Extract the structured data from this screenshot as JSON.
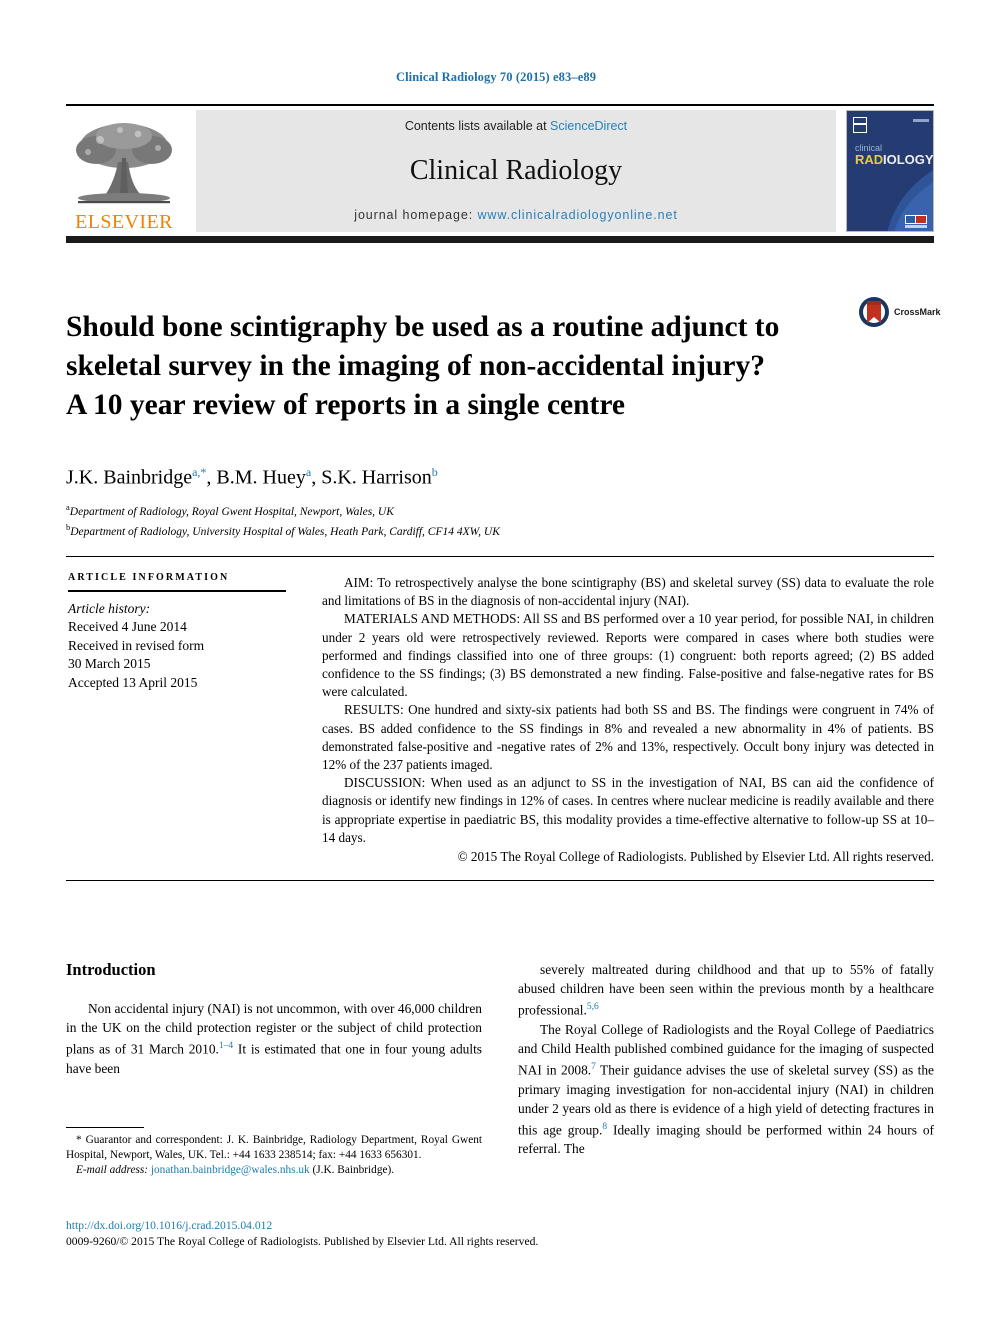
{
  "running_head": "Clinical Radiology 70 (2015) e83–e89",
  "masthead": {
    "contents_prefix": "Contents lists available at ",
    "sciencedirect": "ScienceDirect",
    "journal_title": "Clinical Radiology",
    "homepage_prefix": "journal homepage: ",
    "homepage_url": "www.clinicalradiologyonline.net",
    "publisher_logo_word": "ELSEVIER",
    "cover_line1": "clinical",
    "cover_line2": "RADIOLOGY"
  },
  "crossmark": {
    "label": "CrossMark"
  },
  "article": {
    "title": "Should bone scintigraphy be used as a routine adjunct to skeletal survey in the imaging of non-accidental injury? A 10 year review of reports in a single centre",
    "authors": [
      {
        "name": "J.K. Bainbridge",
        "marks": "a,*"
      },
      {
        "name": "B.M. Huey",
        "marks": "a"
      },
      {
        "name": "S.K. Harrison",
        "marks": "b"
      }
    ],
    "affiliations": [
      {
        "mark": "a",
        "text": "Department of Radiology, Royal Gwent Hospital, Newport, Wales, UK"
      },
      {
        "mark": "b",
        "text": "Department of Radiology, University Hospital of Wales, Heath Park, Cardiff, CF14 4XW, UK"
      }
    ]
  },
  "article_information": {
    "heading": "ARTICLE INFORMATION",
    "history_label": "Article history:",
    "received": "Received 4 June 2014",
    "revised_label": "Received in revised form",
    "revised_date": "30 March 2015",
    "accepted": "Accepted 13 April 2015"
  },
  "abstract": {
    "aim": "AIM: To retrospectively analyse the bone scintigraphy (BS) and skeletal survey (SS) data to evaluate the role and limitations of BS in the diagnosis of non-accidental injury (NAI).",
    "materials": "MATERIALS AND METHODS: All SS and BS performed over a 10 year period, for possible NAI, in children under 2 years old were retrospectively reviewed. Reports were compared in cases where both studies were performed and findings classified into one of three groups: (1) congruent: both reports agreed; (2) BS added confidence to the SS findings; (3) BS demonstrated a new finding. False-positive and false-negative rates for BS were calculated.",
    "results": "RESULTS: One hundred and sixty-six patients had both SS and BS. The findings were congruent in 74% of cases. BS added confidence to the SS findings in 8% and revealed a new abnormality in 4% of patients. BS demonstrated false-positive and -negative rates of 2% and 13%, respectively. Occult bony injury was detected in 12% of the 237 patients imaged.",
    "discussion": "DISCUSSION: When used as an adjunct to SS in the investigation of NAI, BS can aid the confidence of diagnosis or identify new findings in 12% of cases. In centres where nuclear medicine is readily available and there is appropriate expertise in paediatric BS, this modality provides a time-effective alternative to follow-up SS at 10–14 days.",
    "copyright": "© 2015 The Royal College of Radiologists. Published by Elsevier Ltd. All rights reserved."
  },
  "body": {
    "section_heading": "Introduction",
    "left_paragraph_1_a": "Non accidental injury (NAI) is not uncommon, with over 46,000 children in the UK on the child protection register or the subject of child protection plans as of 31 March 2010.",
    "left_paragraph_1_ref": "1–4",
    "left_paragraph_1_b": " It is estimated that one in four young adults have been",
    "right_paragraph_1_a": "severely maltreated during childhood and that up to 55% of fatally abused children have been seen within the previous month by a healthcare professional.",
    "right_paragraph_1_ref": "5,6",
    "right_paragraph_2_a": "The Royal College of Radiologists and the Royal College of Paediatrics and Child Health published combined guidance for the imaging of suspected NAI in 2008.",
    "right_paragraph_2_ref1": "7",
    "right_paragraph_2_b": " Their guidance advises the use of skeletal survey (SS) as the primary imaging investigation for non-accidental injury (NAI) in children under 2 years old as there is evidence of a high yield of detecting fractures in this age group.",
    "right_paragraph_2_ref2": "8",
    "right_paragraph_2_c": " Ideally imaging should be performed within 24 hours of referral. The"
  },
  "footnotes": {
    "correspondence": "* Guarantor and correspondent: J. K. Bainbridge, Radiology Department, Royal Gwent Hospital, Newport, Wales, UK. Tel.: +44 1633 238514; fax: +44 1633 656301.",
    "email_label": "E-mail address: ",
    "email_link": "jonathan.bainbridge@wales.nhs.uk",
    "email_suffix": " (J.K. Bainbridge)."
  },
  "doi_block": {
    "doi_url": "http://dx.doi.org/10.1016/j.crad.2015.04.012",
    "issn_line": "0009-9260/© 2015 The Royal College of Radiologists. Published by Elsevier Ltd. All rights reserved."
  },
  "colors": {
    "link_blue": "#1f7aae",
    "header_blue": "#1f6fa8",
    "elsevier_orange": "#ef8200",
    "masthead_gray": "#e6e6e6",
    "cover_navy": "#243c72",
    "crossmark_red": "#c0321f"
  }
}
